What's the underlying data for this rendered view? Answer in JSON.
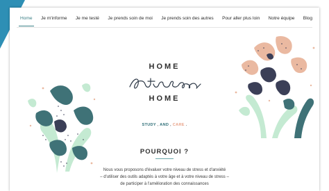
{
  "nav": {
    "items": [
      {
        "label": "Home",
        "active": true
      },
      {
        "label": "Je m'informe"
      },
      {
        "label": "Je me testé"
      },
      {
        "label": "Je prends soin de moi"
      },
      {
        "label": "Je prends soin des autres"
      },
      {
        "label": "Pour aller plus loin"
      },
      {
        "label": "Notre équipe"
      },
      {
        "label": "Blog"
      }
    ],
    "active_color": "#3a7f86"
  },
  "brand": {
    "top": "HOME",
    "script": "stress",
    "bottom": "HOME"
  },
  "tagline": {
    "study": "STUDY",
    "sep1": " , ",
    "and": "AND",
    "sep2": " , ",
    "care": "CARE",
    "end": " ."
  },
  "section": {
    "title": "POURQUOI ?",
    "line1": "Nous vous proposons d'évaluer votre niveau de stress et d'anxiété",
    "line2": "– d'utiliser des outils adaptés à votre âge et à votre niveau de stress –",
    "line3": "de participer à l'amélioration des connaissances"
  },
  "colors": {
    "teal_dark": "#3f7277",
    "mint": "#c4ead2",
    "peach": "#eab9a1",
    "navy": "#3b3f57",
    "corner": "#2e8fb5"
  }
}
